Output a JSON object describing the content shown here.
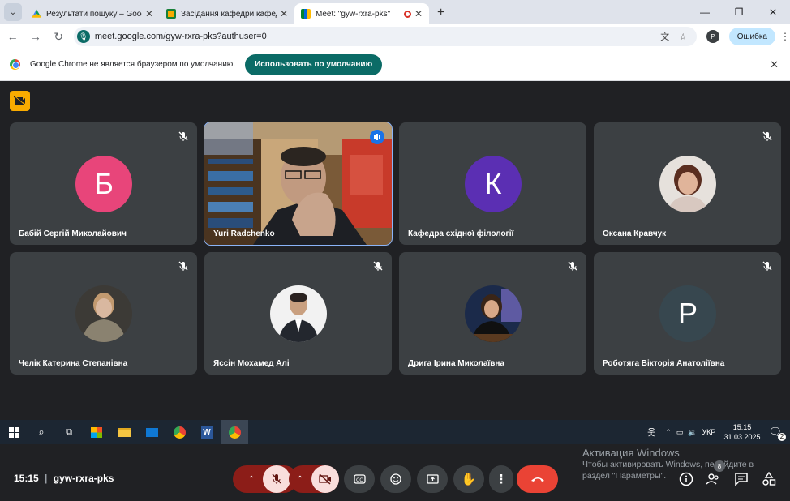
{
  "browser": {
    "tabs": [
      {
        "title": "Результати пошуку – Google Д",
        "icon": "google-drive-icon",
        "active": false
      },
      {
        "title": "Засідання кафедри кафедра сх",
        "icon": "google-classroom-icon",
        "active": false
      },
      {
        "title": "Meet: \"gyw-rxra-pks\"",
        "icon": "google-meet-icon",
        "active": true
      }
    ],
    "url": "meet.google.com/gyw-rxra-pks?authuser=0",
    "profile_initial": "P",
    "error_button": "Ошибка"
  },
  "infobar": {
    "text": "Google Chrome не является браузером по умолчанию.",
    "button": "Использовать по умолчанию"
  },
  "meeting": {
    "code": "gyw-rxra-pks",
    "time": "15:15",
    "participants": [
      {
        "name": "Бабій Сергій Миколайович",
        "initial": "Б",
        "color": "#e8457a",
        "muted": true,
        "video": false
      },
      {
        "name": "Yuri Radchenko",
        "initial": "",
        "color": "",
        "muted": false,
        "video": true,
        "speaking": true
      },
      {
        "name": "Кафедра східної філології",
        "initial": "К",
        "color": "#5b2fb3",
        "muted": false,
        "video": false
      },
      {
        "name": "Оксана Кравчук",
        "initial": "",
        "color": "",
        "muted": true,
        "video": false,
        "photo": true
      },
      {
        "name": "Челік Катерина Степанівна",
        "initial": "",
        "color": "",
        "muted": true,
        "video": false,
        "photo": true
      },
      {
        "name": "Яссін Мохамед Алі",
        "initial": "",
        "color": "",
        "muted": true,
        "video": false,
        "photo": true
      },
      {
        "name": "Дрига Ірина Миколаївна",
        "initial": "",
        "color": "",
        "muted": true,
        "video": false,
        "photo": true
      },
      {
        "name": "Роботяга Вікторія Анатоліївна",
        "initial": "Р",
        "color": "#37474f",
        "muted": true,
        "video": false
      }
    ],
    "people_count": "8"
  },
  "watermark": {
    "title": "Активация Windows",
    "line1": "Чтобы активировать Windows, перейдите в",
    "line2": "раздел \"Параметры\"."
  },
  "taskbar": {
    "lang": "УКР",
    "time": "15:15",
    "date": "31.03.2025",
    "notif_count": "2"
  }
}
